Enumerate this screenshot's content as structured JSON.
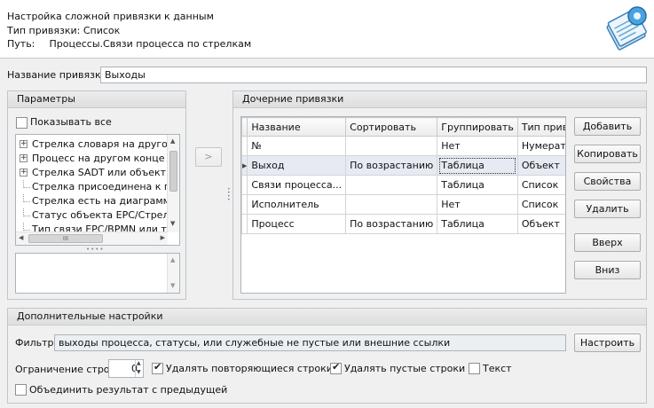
{
  "header": {
    "title": "Настройка сложной привязки к данным",
    "binding_type_label": "Тип привязки:",
    "binding_type_value": "Список",
    "path_label": "Путь:",
    "path_value": "Процессы.Связи процесса по стрелкам",
    "icon": "document-settings-icon"
  },
  "binding_name": {
    "label": "Название привязки",
    "value": "Выходы"
  },
  "params": {
    "title": "Параметры",
    "show_all_label": "Показывать все",
    "show_all_checked": false,
    "tree_items": [
      {
        "label": "Стрелка словаря на другом",
        "expandable": true
      },
      {
        "label": "Процесс на другом конце",
        "expandable": true
      },
      {
        "label": "Стрелка SADT или объект E",
        "expandable": true
      },
      {
        "label": "Стрелка присоединена к пр",
        "expandable": false
      },
      {
        "label": "Стрелка есть на диаграмме",
        "expandable": false
      },
      {
        "label": "Статус объекта EPC/Стрел",
        "expandable": false
      },
      {
        "label": "Тип связи EPC/BPMN или т",
        "expandable": false
      }
    ],
    "h_scroll_thumb": "III",
    "splitter": "••••",
    "description": ""
  },
  "move_button": ">",
  "children": {
    "title": "Дочерние привязки",
    "columns": [
      "Название",
      "Сортировать",
      "Группировать",
      "Тип привязки"
    ],
    "rows": [
      {
        "name": "№",
        "sort": "",
        "group": "Нет",
        "type": "Нумератор"
      },
      {
        "name": "Выход",
        "sort": "По возрастанию",
        "group": "Таблица",
        "type": "Объект"
      },
      {
        "name": "Связи процесса...",
        "sort": "",
        "group": "Таблица",
        "type": "Список"
      },
      {
        "name": "Исполнитель",
        "sort": "",
        "group": "Нет",
        "type": "Список"
      },
      {
        "name": "Процесс",
        "sort": "По возрастанию",
        "group": "Таблица",
        "type": "Объект"
      }
    ],
    "selected_row": 1,
    "row_indicator": "▶",
    "buttons": {
      "add": "Добавить",
      "copy": "Копировать",
      "properties": "Свойства",
      "delete": "Удалить",
      "up": "Вверх",
      "down": "Вниз"
    }
  },
  "extra": {
    "title": "Дополнительные настройки",
    "filter_label": "Фильтр",
    "filter_value": "выходы процесса, статусы, или служебные не пустые или внешние ссылки",
    "configure_button": "Настроить",
    "row_limit_label": "Ограничение строк",
    "row_limit_value": "0",
    "remove_duplicates_label": "Удалять повторяющиеся строки",
    "remove_duplicates_checked": true,
    "remove_empty_label": "Удалять пустые строки",
    "remove_empty_checked": true,
    "text_label": "Текст",
    "text_checked": false,
    "merge_label": "Объединить результат с предыдущей",
    "merge_checked": false
  }
}
